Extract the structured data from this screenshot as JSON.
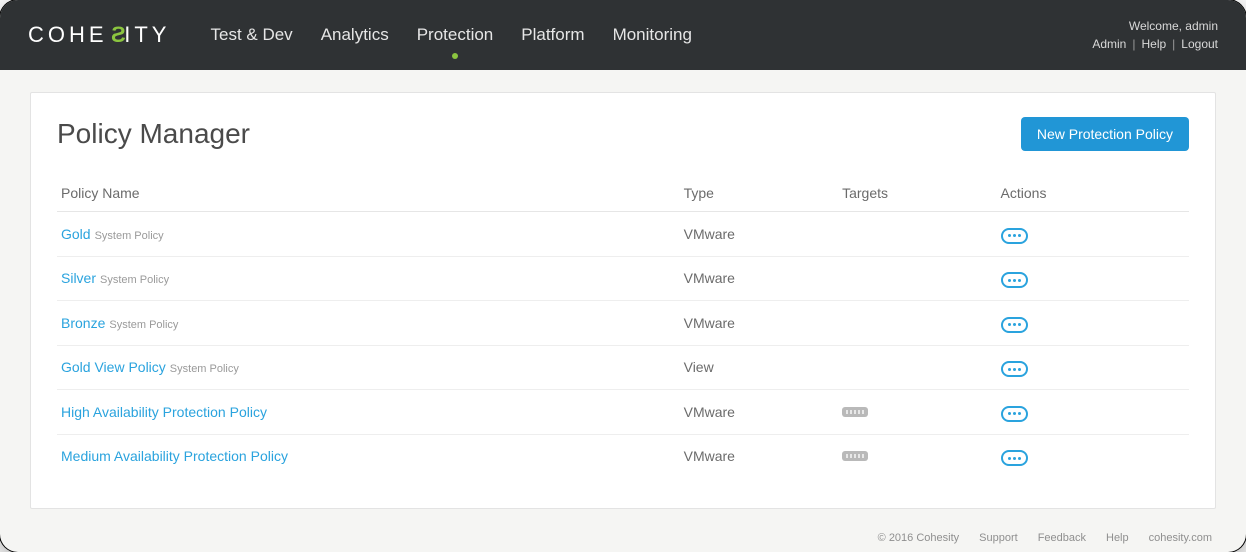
{
  "brand": {
    "pre": "COHE",
    "s": "S",
    "post": "ITY"
  },
  "nav": {
    "items": [
      {
        "label": "Test & Dev",
        "active": false
      },
      {
        "label": "Analytics",
        "active": false
      },
      {
        "label": "Protection",
        "active": true
      },
      {
        "label": "Platform",
        "active": false
      },
      {
        "label": "Monitoring",
        "active": false
      }
    ]
  },
  "user": {
    "welcome": "Welcome, admin",
    "links": {
      "admin": "Admin",
      "help": "Help",
      "logout": "Logout"
    }
  },
  "page": {
    "title": "Policy Manager",
    "primary_button": "New Protection Policy"
  },
  "table": {
    "headers": {
      "name": "Policy Name",
      "type": "Type",
      "targets": "Targets",
      "actions": "Actions"
    },
    "system_tag": "System Policy",
    "rows": [
      {
        "name": "Gold",
        "system": true,
        "type": "VMware",
        "has_target": false,
        "tall": false
      },
      {
        "name": "Silver",
        "system": true,
        "type": "VMware",
        "has_target": false,
        "tall": false
      },
      {
        "name": "Bronze",
        "system": true,
        "type": "VMware",
        "has_target": false,
        "tall": false
      },
      {
        "name": "Gold View Policy",
        "system": true,
        "type": "View",
        "has_target": false,
        "tall": false
      },
      {
        "name": "High Availability Protection Policy",
        "system": false,
        "type": "VMware",
        "has_target": true,
        "tall": true
      },
      {
        "name": "Medium Availability Protection Policy",
        "system": false,
        "type": "VMware",
        "has_target": true,
        "tall": true
      }
    ]
  },
  "footer": {
    "copyright": "© 2016 Cohesity",
    "support": "Support",
    "feedback": "Feedback",
    "help": "Help",
    "site": "cohesity.com"
  }
}
